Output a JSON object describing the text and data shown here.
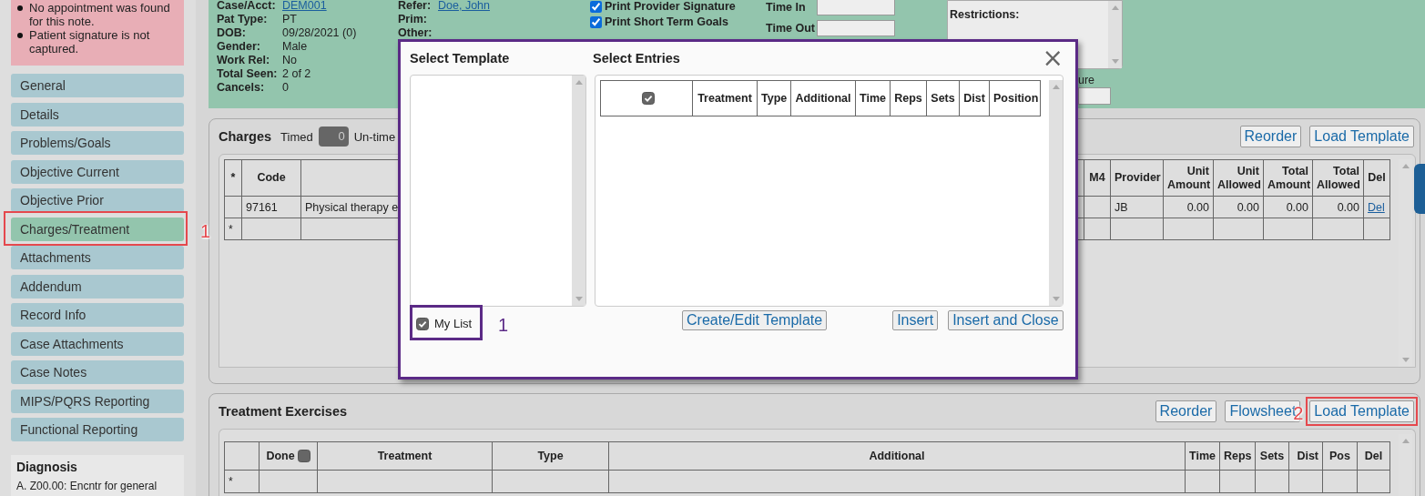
{
  "alerts": [
    "No appointment was found for this note.",
    "Patient signature is not captured."
  ],
  "nav": [
    {
      "label": "General",
      "selected": false
    },
    {
      "label": "Details",
      "selected": false
    },
    {
      "label": "Problems/Goals",
      "selected": false
    },
    {
      "label": "Objective Current",
      "selected": false
    },
    {
      "label": "Objective Prior",
      "selected": false
    },
    {
      "label": "Charges/Treatment",
      "selected": true,
      "annotation": {
        "label": "1",
        "color": "#e5484d"
      }
    },
    {
      "label": "Attachments",
      "selected": false
    },
    {
      "label": "Addendum",
      "selected": false
    },
    {
      "label": "Record Info",
      "selected": false
    },
    {
      "label": "Case Attachments",
      "selected": false
    },
    {
      "label": "Case Notes",
      "selected": false
    },
    {
      "label": "MIPS/PQRS Reporting",
      "selected": false
    },
    {
      "label": "Functional Reporting",
      "selected": false
    }
  ],
  "diagnosis": {
    "title": "Diagnosis",
    "items": [
      "A. Z00.00: Encntr for general"
    ]
  },
  "patient_info": [
    {
      "label": "Case/Acct:",
      "value": "DEM001",
      "kind": "link"
    },
    {
      "label": "Pat Type:",
      "value": "PT",
      "kind": "text"
    },
    {
      "label": "DOB:",
      "value": "09/28/2021 (0)",
      "kind": "text"
    },
    {
      "label": "Gender:",
      "value": "Male",
      "kind": "text"
    },
    {
      "label": "Work Rel:",
      "value": "No",
      "kind": "text"
    },
    {
      "label": "Total Seen:",
      "value": "2 of 2",
      "kind": "text"
    },
    {
      "label": "Cancels:",
      "value": "0",
      "kind": "text"
    }
  ],
  "referral_info": [
    {
      "label": "Refer:",
      "value": "Doe, John",
      "kind": "link"
    },
    {
      "label": "Prim:"
    },
    {
      "label": "Other:"
    }
  ],
  "print_options": [
    {
      "label": "Print Provider Signature",
      "checked": true
    },
    {
      "label": "Print Short Term Goals",
      "checked": true
    }
  ],
  "time_fields": [
    {
      "label": "Time In"
    },
    {
      "label": "Time Out"
    }
  ],
  "restrictions": {
    "label": "Restrictions:"
  },
  "signature": {
    "label": "ure"
  },
  "charges": {
    "title": "Charges",
    "timed": {
      "label": "Timed",
      "value": "0"
    },
    "untimed_label": "Un-time",
    "buttons": [
      {
        "label": "Reorder"
      },
      {
        "label": "Load Template"
      }
    ],
    "columns": [
      {
        "label": "*"
      },
      {
        "label": "Code"
      },
      {},
      {
        "label": "M4"
      },
      {
        "label": "Provider"
      },
      {
        "label": "Unit Amount"
      },
      {
        "label": "Unit Allowed"
      },
      {
        "label": "Total Amount"
      },
      {
        "label": "Total Allowed"
      },
      {
        "label": "Del",
        "kind": "link"
      }
    ],
    "rows": [
      [
        null,
        "97161",
        "Physical therapy e",
        null,
        "JB",
        "0.00",
        "0.00",
        "0.00",
        "0.00",
        "Del"
      ],
      [
        "*",
        null,
        null,
        null,
        null,
        null,
        null,
        null,
        null,
        null
      ]
    ]
  },
  "exercises": {
    "title": "Treatment Exercises",
    "buttons": [
      {
        "label": "Reorder"
      },
      {
        "label": "Flowsheet"
      },
      {
        "label": "Load Template",
        "annotation": {
          "label": "2",
          "color": "#e5484d"
        }
      }
    ],
    "columns": [
      {},
      {
        "label": "Done",
        "checkbox": {
          "checked": false
        }
      },
      {
        "label": "Treatment"
      },
      {
        "label": "Type"
      },
      {
        "label": "Additional"
      },
      {
        "label": "Time"
      },
      {
        "label": "Reps"
      },
      {
        "label": "Sets"
      },
      {
        "label": "Dist"
      },
      {
        "label": "Pos"
      },
      {
        "label": "Del"
      }
    ],
    "rows": [
      [
        "*",
        null,
        null,
        null,
        null,
        null,
        null,
        null,
        null,
        null,
        null
      ]
    ]
  },
  "modal": {
    "template_title": "Select Template",
    "entries_title": "Select Entries",
    "close": "×",
    "my_list": {
      "label": "My List",
      "checked": true,
      "annotation": {
        "label": "1",
        "color": "#5b2a86"
      }
    },
    "columns": [
      {
        "checkbox": {
          "checked": true
        }
      },
      {
        "label": "Treatment"
      },
      {
        "label": "Type"
      },
      {
        "label": "Additional"
      },
      {
        "label": "Time"
      },
      {
        "label": "Reps"
      },
      {
        "label": "Sets"
      },
      {
        "label": "Dist"
      },
      {
        "label": "Position"
      }
    ],
    "buttons": [
      {
        "label": "Create/Edit Template",
        "kind": "left"
      },
      {
        "label": "Insert",
        "kind": "right"
      },
      {
        "label": "Insert and Close",
        "kind": "right"
      }
    ]
  }
}
